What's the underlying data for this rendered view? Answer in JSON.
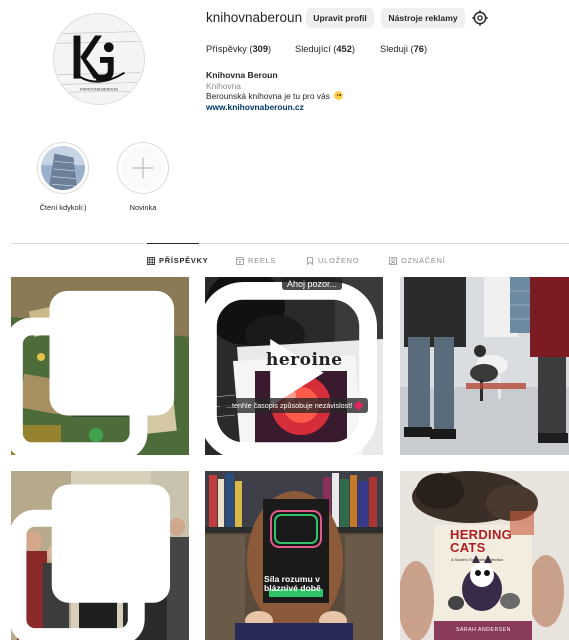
{
  "profile": {
    "username": "knihovnaberoun",
    "edit_button": "Upravit profil",
    "ads_button": "Nástroje reklamy",
    "stats": {
      "posts_label": "Příspěvky",
      "posts_count": "309",
      "followers_label": "Sledující",
      "followers_count": "452",
      "following_label": "Sleduji",
      "following_count": "76"
    },
    "bio": {
      "name": "Knihovna Beroun",
      "category": "Knihovna",
      "text": "Berounská knihovna je tu pro vás",
      "link": "www.knihovnaberoun.cz"
    }
  },
  "highlights": [
    {
      "label": "Čtení kdykoli:)"
    },
    {
      "label": "Novinka"
    }
  ],
  "tabs": [
    {
      "label": "PŘÍSPĚVKY",
      "active": true
    },
    {
      "label": "REELS",
      "active": false
    },
    {
      "label": "ULOŽENO",
      "active": false
    },
    {
      "label": "OZNAČENÍ",
      "active": false
    }
  ],
  "posts": {
    "p2_top_text": "Ahoj pozor...",
    "p2_magazine": "heroine",
    "p2_caption": "...tenhle časopis způsobuje nezávislost!",
    "p5_book_title": "Síla rozumu v bláznivé době",
    "p6_book_title_line1": "HERDING",
    "p6_book_title_line2": "CATS",
    "p6_subtitle": "A Sarah's Scribbles collection",
    "p6_author": "SARAH ANDERSEN"
  },
  "colors": {
    "link": "#00376b",
    "muted": "#8e8e8e",
    "button_bg": "#efefef"
  }
}
